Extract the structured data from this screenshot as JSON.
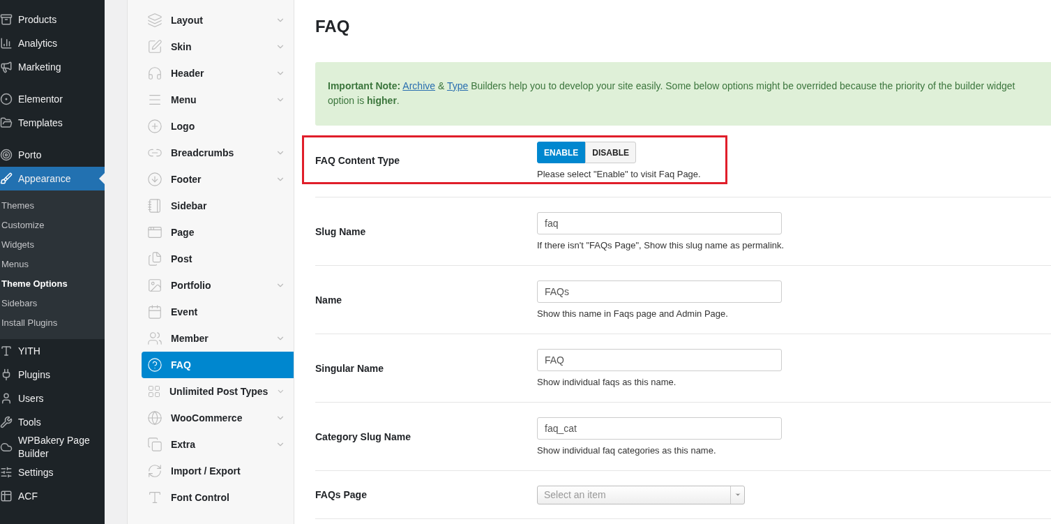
{
  "admin_menu": {
    "groups": [
      [
        {
          "label": "Products",
          "selected": false
        },
        {
          "label": "Analytics",
          "selected": false
        },
        {
          "label": "Marketing",
          "selected": false
        }
      ],
      [
        {
          "label": "Elementor",
          "selected": false
        },
        {
          "label": "Templates",
          "selected": false
        }
      ],
      [
        {
          "label": "Porto",
          "selected": false
        },
        {
          "label": "Appearance",
          "selected": true,
          "children": [
            {
              "label": "Themes",
              "selected": false
            },
            {
              "label": "Customize",
              "selected": false
            },
            {
              "label": "Widgets",
              "selected": false
            },
            {
              "label": "Menus",
              "selected": false
            },
            {
              "label": "Theme Options",
              "selected": true
            },
            {
              "label": "Sidebars",
              "selected": false
            },
            {
              "label": "Install Plugins",
              "selected": false
            }
          ]
        },
        {
          "label": "YITH",
          "selected": false
        },
        {
          "label": "Plugins",
          "selected": false
        },
        {
          "label": "Users",
          "selected": false
        },
        {
          "label": "Tools",
          "selected": false
        },
        {
          "label": "WPBakery Page Builder",
          "selected": false
        },
        {
          "label": "Settings",
          "selected": false
        },
        {
          "label": "ACF",
          "selected": false
        }
      ]
    ]
  },
  "options_nav": {
    "items": [
      {
        "label": "Layout",
        "selected": false,
        "expandable": true
      },
      {
        "label": "Skin",
        "selected": false,
        "expandable": true
      },
      {
        "label": "Header",
        "selected": false,
        "expandable": true
      },
      {
        "label": "Menu",
        "selected": false,
        "expandable": true
      },
      {
        "label": "Logo",
        "selected": false,
        "expandable": false
      },
      {
        "label": "Breadcrumbs",
        "selected": false,
        "expandable": true
      },
      {
        "label": "Footer",
        "selected": false,
        "expandable": true
      },
      {
        "label": "Sidebar",
        "selected": false,
        "expandable": false
      },
      {
        "label": "Page",
        "selected": false,
        "expandable": false
      },
      {
        "label": "Post",
        "selected": false,
        "expandable": false
      },
      {
        "label": "Portfolio",
        "selected": false,
        "expandable": true
      },
      {
        "label": "Event",
        "selected": false,
        "expandable": false
      },
      {
        "label": "Member",
        "selected": false,
        "expandable": true
      },
      {
        "label": "FAQ",
        "selected": true,
        "expandable": false
      },
      {
        "label": "Unlimited Post Types",
        "selected": false,
        "expandable": true
      },
      {
        "label": "WooCommerce",
        "selected": false,
        "expandable": true
      },
      {
        "label": "Extra",
        "selected": false,
        "expandable": true
      },
      {
        "label": "Import / Export",
        "selected": false,
        "expandable": false
      },
      {
        "label": "Font Control",
        "selected": false,
        "expandable": false
      }
    ]
  },
  "page": {
    "title": "FAQ",
    "note": {
      "prefix": "**Important Note:**",
      "link_1": "Archive",
      "between": "&",
      "link_2": "Type",
      "text": "Builders help you to develop your site easily. Some below options might be overrided because the priority of the builder widget option is **higher**."
    },
    "fields": [
      {
        "kind": "toggle",
        "label": "FAQ Content Type",
        "highlighted": true,
        "options": [
          {
            "label": "ENABLE",
            "selected": true
          },
          {
            "label": "DISABLE",
            "selected": false
          }
        ],
        "description": "Please select \"Enable\" to visit Faq Page."
      },
      {
        "kind": "text",
        "label": "Slug Name",
        "highlighted": false,
        "value": "faq",
        "description": "If there isn't \"FAQs Page\", Show this slug name as permalink."
      },
      {
        "kind": "text",
        "label": "Name",
        "highlighted": false,
        "value": "FAQs",
        "description": "Show this name in Faqs page and Admin Page."
      },
      {
        "kind": "text",
        "label": "Singular Name",
        "highlighted": false,
        "value": "FAQ",
        "description": "Show individual faqs as this name."
      },
      {
        "kind": "text",
        "label": "Category Slug Name",
        "highlighted": false,
        "value": "faq_cat",
        "description": "Show individual faq categories as this name."
      },
      {
        "kind": "select",
        "label": "FAQs Page",
        "highlighted": false,
        "placeholder": "Select an item"
      }
    ]
  }
}
